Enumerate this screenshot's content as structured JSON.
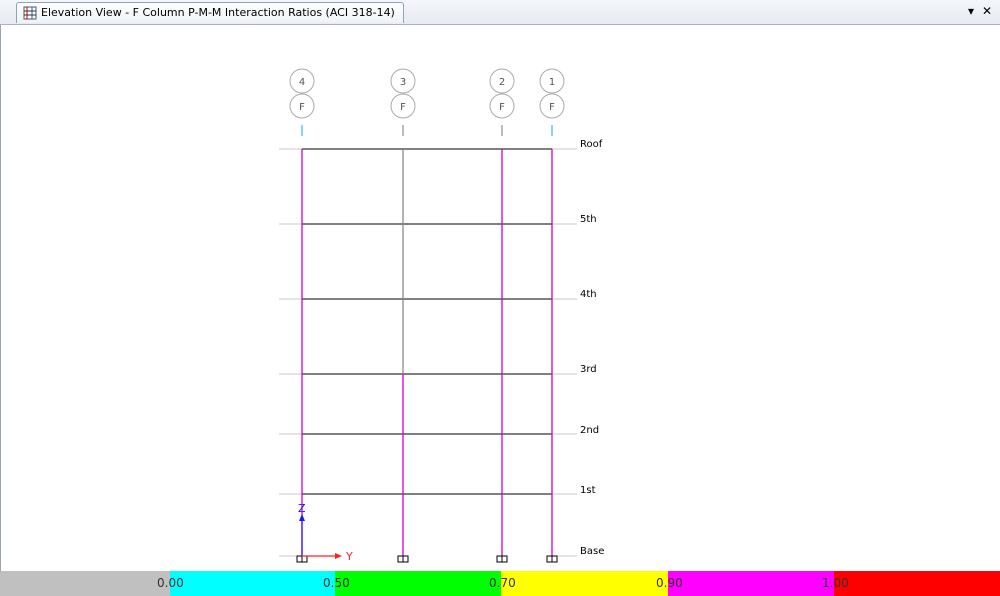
{
  "window": {
    "title": "Elevation View - F  Column P-M-M Interaction Ratios  (ACI 318-14)",
    "dropdown_glyph": "▾",
    "close_glyph": "✕"
  },
  "grid_lines": [
    {
      "label": "4",
      "bay": "F"
    },
    {
      "label": "3",
      "bay": "F"
    },
    {
      "label": "2",
      "bay": "F"
    },
    {
      "label": "1",
      "bay": "F"
    }
  ],
  "stories": [
    "Roof",
    "5th",
    "4th",
    "3rd",
    "2nd",
    "1st",
    "Base"
  ],
  "axes": {
    "z": "Z",
    "y": "Y"
  },
  "legend": {
    "ticks": [
      "0.00",
      "0.50",
      "0.70",
      "0.90",
      "1.00"
    ],
    "colors": [
      "#c0c0c0",
      "#00ffff",
      "#00ff00",
      "#ffff00",
      "#ff00ff",
      "#ff0000"
    ]
  },
  "colors": {
    "column_magenta": "#cc00cc",
    "column_gray": "#8a8a8a",
    "beam": "#000000",
    "grid_cyan": "#00b4e6"
  }
}
